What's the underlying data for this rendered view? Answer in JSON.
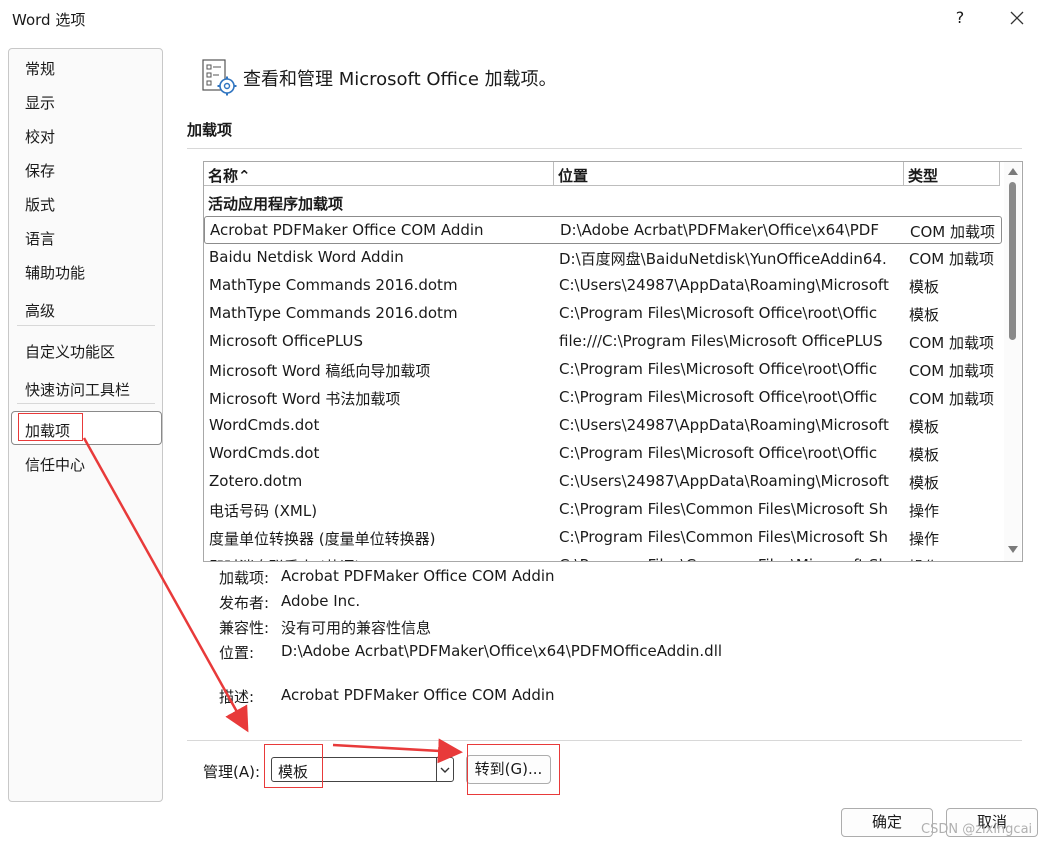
{
  "window": {
    "title": "Word 选项",
    "help": "?",
    "close": "✕"
  },
  "sidebar": {
    "items": [
      {
        "label": "常规"
      },
      {
        "label": "显示"
      },
      {
        "label": "校对"
      },
      {
        "label": "保存"
      },
      {
        "label": "版式"
      },
      {
        "label": "语言"
      },
      {
        "label": "辅助功能"
      },
      {
        "label": "高级"
      },
      {
        "label": "自定义功能区"
      },
      {
        "label": "快速访问工具栏"
      },
      {
        "label": "加载项"
      },
      {
        "label": "信任中心"
      }
    ],
    "selected": "加载项"
  },
  "main": {
    "heading": "查看和管理 Microsoft Office 加载项。",
    "section_title": "加载项",
    "table": {
      "columns": [
        {
          "label": "名称⌃"
        },
        {
          "label": "位置"
        },
        {
          "label": "类型"
        }
      ],
      "group_label": "活动应用程序加载项",
      "rows": [
        {
          "name": "Acrobat PDFMaker Office COM Addin",
          "location": "D:\\Adobe Acrbat\\PDFMaker\\Office\\x64\\PDF",
          "type": "COM 加载项"
        },
        {
          "name": "Baidu Netdisk Word Addin",
          "location": "D:\\百度网盘\\BaiduNetdisk\\YunOfficeAddin64.",
          "type": "COM 加载项"
        },
        {
          "name": "MathType Commands 2016.dotm",
          "location": "C:\\Users\\24987\\AppData\\Roaming\\Microsoft",
          "type": "模板"
        },
        {
          "name": "MathType Commands 2016.dotm",
          "location": "C:\\Program Files\\Microsoft Office\\root\\Offic",
          "type": "模板"
        },
        {
          "name": "Microsoft OfficePLUS",
          "location": "file:///C:\\Program Files\\Microsoft OfficePLUS",
          "type": "COM 加载项"
        },
        {
          "name": "Microsoft Word 稿纸向导加载项",
          "location": "C:\\Program Files\\Microsoft Office\\root\\Offic",
          "type": "COM 加载项"
        },
        {
          "name": "Microsoft Word 书法加载项",
          "location": "C:\\Program Files\\Microsoft Office\\root\\Offic",
          "type": "COM 加载项"
        },
        {
          "name": "WordCmds.dot",
          "location": "C:\\Users\\24987\\AppData\\Roaming\\Microsoft",
          "type": "模板"
        },
        {
          "name": "WordCmds.dot",
          "location": "C:\\Program Files\\Microsoft Office\\root\\Offic",
          "type": "模板"
        },
        {
          "name": "Zotero.dotm",
          "location": "C:\\Users\\24987\\AppData\\Roaming\\Microsoft",
          "type": "模板"
        },
        {
          "name": "电话号码 (XML)",
          "location": "C:\\Program Files\\Common Files\\Microsoft Sh",
          "type": "操作"
        },
        {
          "name": "度量单位转换器 (度量单位转换器)",
          "location": "C:\\Program Files\\Common Files\\Microsoft Sh",
          "type": "操作"
        },
        {
          "name": "即时消息联系人 (英语)",
          "location": "C:\\Program Files\\Common Files\\Microsoft Sh",
          "type": "操作"
        }
      ]
    },
    "details": {
      "addin_label": "加载项:",
      "addin_value": "Acrobat PDFMaker Office COM Addin",
      "publisher_label": "发布者:",
      "publisher_value": "Adobe Inc.",
      "compat_label": "兼容性:",
      "compat_value": "没有可用的兼容性信息",
      "location_label": "位置:",
      "location_value": "D:\\Adobe Acrbat\\PDFMaker\\Office\\x64\\PDFMOfficeAddin.dll",
      "desc_label": "描述:",
      "desc_value": "Acrobat PDFMaker Office COM Addin"
    },
    "manage": {
      "label": "管理(A):",
      "selected": "模板",
      "go_button": "转到(G)..."
    }
  },
  "footer": {
    "ok": "确定",
    "cancel": "取消"
  },
  "watermark": "CSDN @zixingcai",
  "colors": {
    "annotation": "#e83a3a",
    "scrollbar_thumb": "#8a8a8a"
  }
}
